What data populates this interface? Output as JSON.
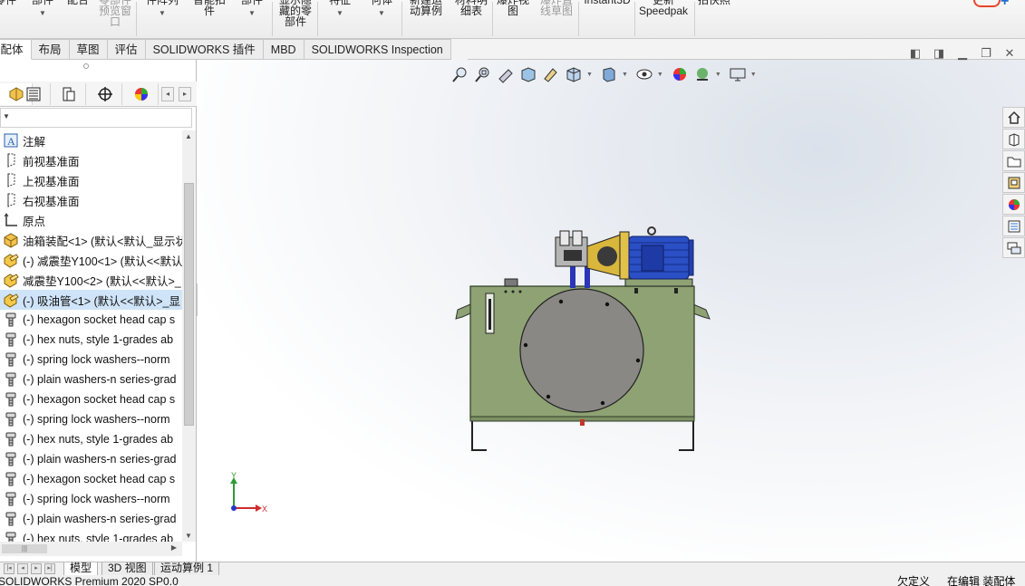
{
  "ribbon": {
    "items": [
      {
        "lines": [
          "零件"
        ],
        "dropdown": false,
        "disabled": false
      },
      {
        "lines": [
          "部件"
        ],
        "dropdown": true,
        "disabled": false
      },
      {
        "lines": [
          "配合"
        ],
        "dropdown": false,
        "disabled": false
      },
      {
        "lines": [
          "零部件",
          "预览窗",
          "口"
        ],
        "dropdown": false,
        "disabled": true
      },
      {
        "lines": [
          "件阵列"
        ],
        "dropdown": true,
        "disabled": false
      },
      {
        "lines": [
          "智能扣",
          "件"
        ],
        "dropdown": false,
        "disabled": false
      },
      {
        "lines": [
          "部件"
        ],
        "dropdown": true,
        "disabled": false
      },
      {
        "lines": [
          "显示隐",
          "藏的零",
          "部件"
        ],
        "dropdown": false,
        "disabled": false
      },
      {
        "lines": [
          "特征"
        ],
        "dropdown": true,
        "disabled": false
      },
      {
        "lines": [
          "何体"
        ],
        "dropdown": true,
        "disabled": false
      },
      {
        "lines": [
          "新建运",
          "动算例"
        ],
        "dropdown": false,
        "disabled": false
      },
      {
        "lines": [
          "材料明",
          "细表"
        ],
        "dropdown": false,
        "disabled": false
      },
      {
        "lines": [
          "爆炸视",
          "图"
        ],
        "dropdown": false,
        "disabled": false
      },
      {
        "lines": [
          "爆炸直",
          "线草图"
        ],
        "dropdown": false,
        "disabled": true
      },
      {
        "lines": [
          "Instant3D"
        ],
        "dropdown": false,
        "disabled": false
      },
      {
        "lines": [
          "更新",
          "Speedpak"
        ],
        "dropdown": false,
        "disabled": false
      },
      {
        "lines": [
          "拍快照"
        ],
        "dropdown": false,
        "disabled": false
      }
    ]
  },
  "tabs": [
    "装配体",
    "布局",
    "草图",
    "评估",
    "SOLIDWORKS 插件",
    "MBD",
    "SOLIDWORKS Inspection"
  ],
  "active_tab": 0,
  "tree": {
    "items": [
      {
        "label": "注解",
        "icon": "annotation-icon"
      },
      {
        "label": "前视基准面",
        "icon": "plane-icon"
      },
      {
        "label": "上视基准面",
        "icon": "plane-icon"
      },
      {
        "label": "右视基准面",
        "icon": "plane-icon"
      },
      {
        "label": "原点",
        "icon": "origin-icon"
      },
      {
        "label": "油箱装配<1> (默认<默认_显示状",
        "icon": "subassembly-icon"
      },
      {
        "label": "(-) 减震垫Y100<1> (默认<<默认>",
        "icon": "part-icon"
      },
      {
        "label": "减震垫Y100<2> (默认<<默认>_",
        "icon": "part-icon"
      },
      {
        "label": "(-) 吸油管<1> (默认<<默认>_显",
        "icon": "part-icon",
        "selected": true
      },
      {
        "label": "(-) hexagon socket head cap s",
        "icon": "fastener-icon"
      },
      {
        "label": "(-) hex nuts, style 1-grades ab",
        "icon": "fastener-icon"
      },
      {
        "label": "(-) spring lock washers--norm",
        "icon": "fastener-icon"
      },
      {
        "label": "(-) plain washers-n series-grad",
        "icon": "fastener-icon"
      },
      {
        "label": "(-) hexagon socket head cap s",
        "icon": "fastener-icon"
      },
      {
        "label": "(-) spring lock washers--norm",
        "icon": "fastener-icon"
      },
      {
        "label": "(-) hex nuts, style 1-grades ab",
        "icon": "fastener-icon"
      },
      {
        "label": "(-) plain washers-n series-grad",
        "icon": "fastener-icon"
      },
      {
        "label": "(-) hexagon socket head cap s",
        "icon": "fastener-icon"
      },
      {
        "label": "(-) spring lock washers--norm",
        "icon": "fastener-icon"
      },
      {
        "label": "(-) plain washers-n series-grad",
        "icon": "fastener-icon"
      },
      {
        "label": "(-) hex nuts, style 1-grades ab",
        "icon": "fastener-icon"
      }
    ]
  },
  "triad": {
    "x": "X",
    "y": "Y"
  },
  "bottom_tabs": [
    "模型",
    "3D 视图",
    "运动算例 1"
  ],
  "status": {
    "left": "SOLIDWORKS Premium 2020 SP0.0",
    "center": "欠定义",
    "right": "在编辑 装配体"
  },
  "colors": {
    "tank": "#8ea274",
    "motor": "#2b4fc4",
    "coupling": "#d9b63c",
    "cover": "#8a8885",
    "pipe": "#2a35b8"
  }
}
